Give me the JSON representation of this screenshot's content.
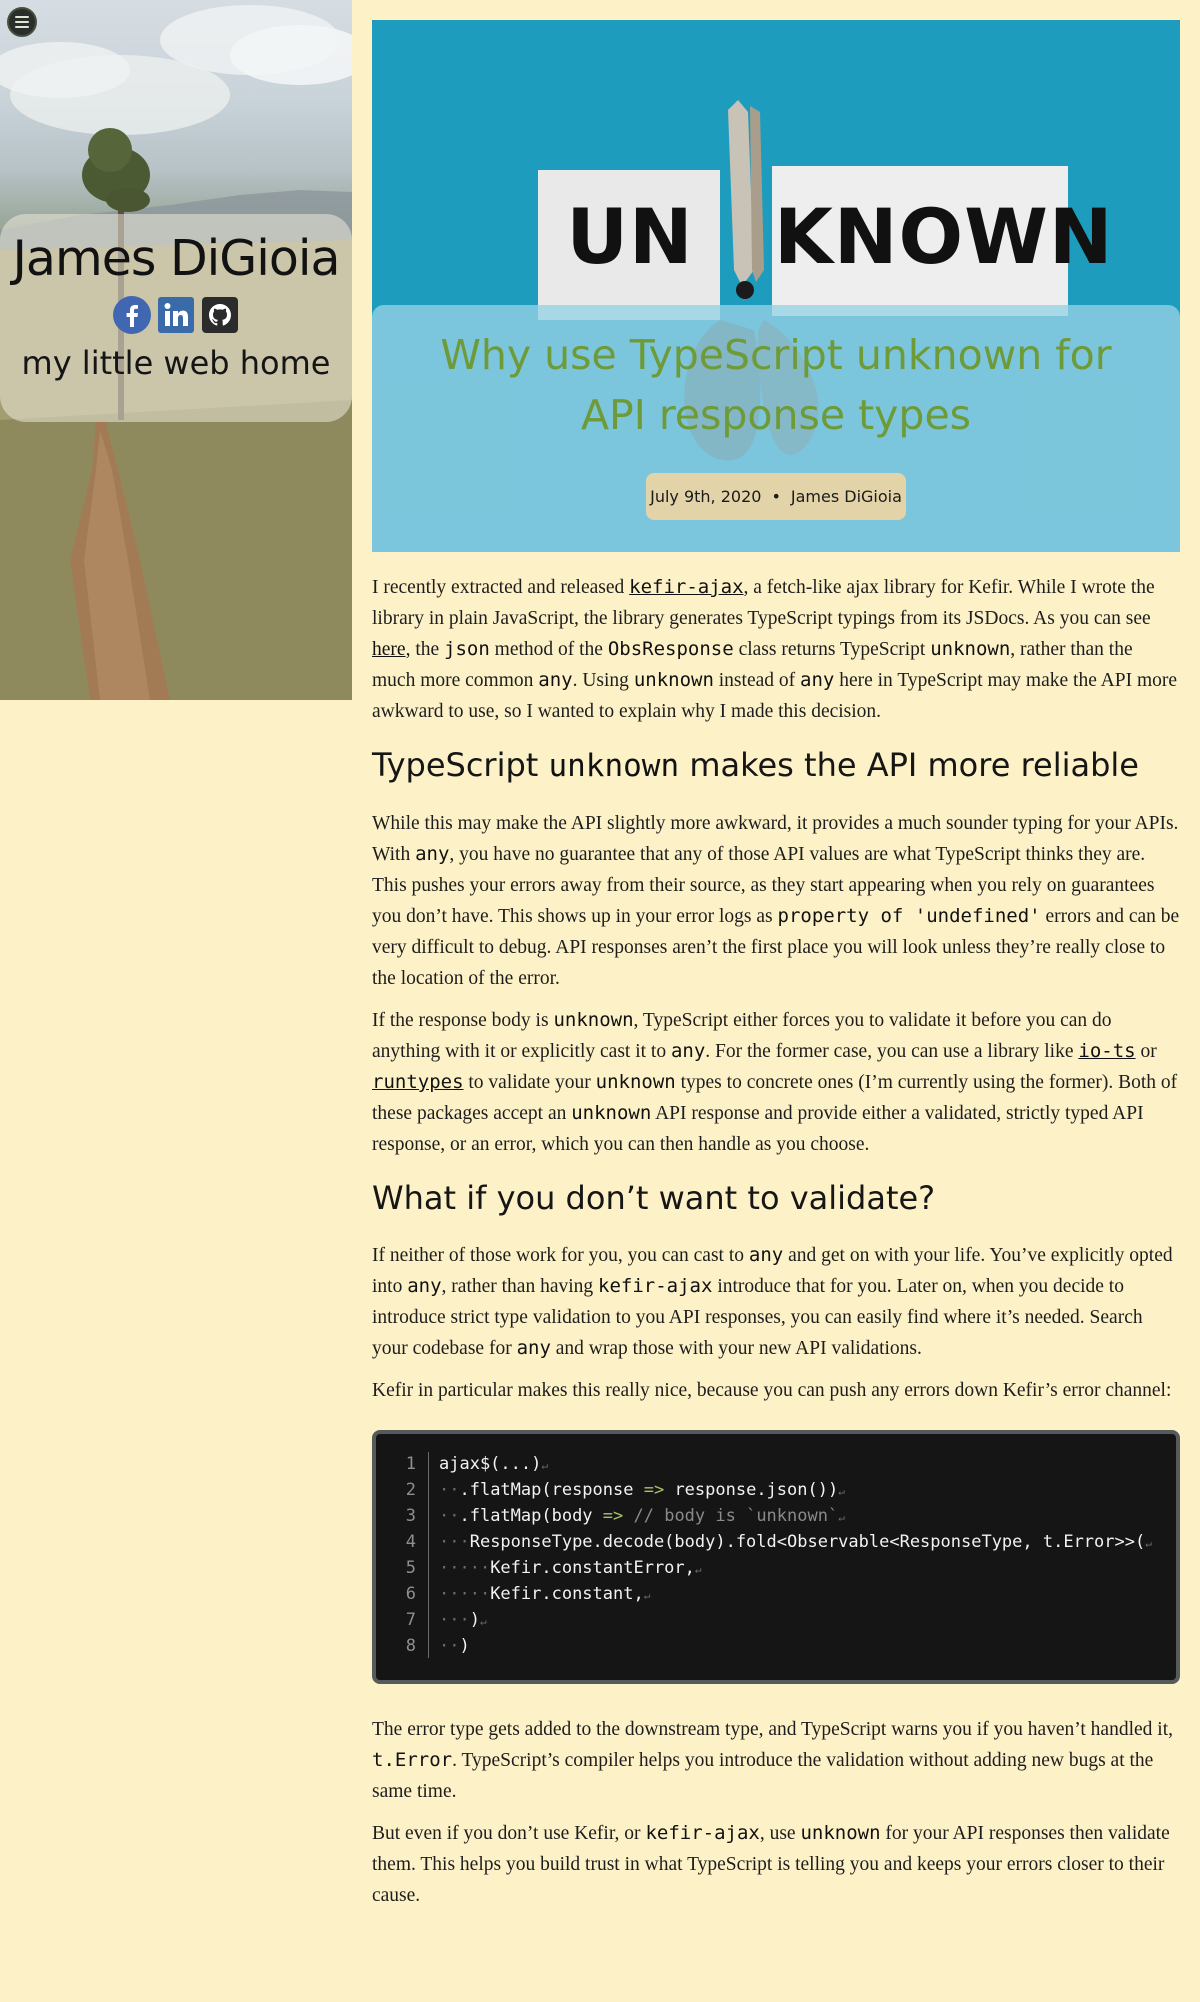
{
  "sidebar": {
    "menu_icon": "hamburger-menu-icon",
    "site_name": "James DiGioia",
    "tagline": "my little web home",
    "social": [
      {
        "name": "facebook-icon",
        "color": "#4267b2"
      },
      {
        "name": "linkedin-icon",
        "color": "#3b6aa8"
      },
      {
        "name": "github-icon",
        "color": "#2b2b2b"
      }
    ]
  },
  "hero": {
    "image_text_left": "UN",
    "image_text_right": "KNOWN",
    "title": "Why use TypeScript unknown for API response types",
    "date": "July 9th, 2020",
    "separator": "•",
    "author": "James DiGioia"
  },
  "article": {
    "p1": {
      "t1": "I recently extracted and released ",
      "link1": "kefir-ajax",
      "t2": ", a fetch-like ajax library for Kefir. While I wrote the library in plain JavaScript, the library generates TypeScript typings from its JSDocs. As you can see ",
      "link2": "here",
      "t3": ", the ",
      "c1": "json",
      "t4": " method of the ",
      "c2": "ObsResponse",
      "t5": " class returns TypeScript ",
      "c3": "unknown",
      "t6": ", rather than the much more common ",
      "c4": "any",
      "t7": ". Using ",
      "c5": "unknown",
      "t8": " instead of ",
      "c6": "any",
      "t9": " here in TypeScript may make the API more awkward to use, so I wanted to explain why I made this decision."
    },
    "h1": {
      "t1": "TypeScript ",
      "c1": "unknown",
      "t2": " makes the API more reliable"
    },
    "p2": {
      "t1": "While this may make the API slightly more awkward, it provides a much sounder typing for your APIs. With ",
      "c1": "any",
      "t2": ", you have no guarantee that any of those API values are what TypeScript thinks they are. This pushes your errors away from their source, as they start appearing when you rely on guarantees you don’t have. This shows up in your error logs as ",
      "c2": "property of 'undefined'",
      "t3": " errors and can be very difficult to debug. API responses aren’t the first place you will look unless they’re really close to the location of the error."
    },
    "p3": {
      "t1": "If the response body is ",
      "c1": "unknown",
      "t2": ", TypeScript either forces you to validate it before you can do anything with it or explicitly cast it to ",
      "c2": "any",
      "t3": ". For the former case, you can use a library like ",
      "link1": "io-ts",
      "t4": " or ",
      "link2": "runtypes",
      "t5": " to validate your ",
      "c3": "unknown",
      "t6": " types to concrete ones (I’m currently using the former). Both of these packages accept an ",
      "c4": "unknown",
      "t7": " API response and provide either a validated, strictly typed API response, or an error, which you can then handle as you choose."
    },
    "h2": "What if you don’t want to validate?",
    "p4": {
      "t1": "If neither of those work for you, you can cast to ",
      "c1": "any",
      "t2": " and get on with your life. You’ve explicitly opted into ",
      "c2": "any",
      "t3": ", rather than having ",
      "c3": "kefir-ajax",
      "t4": " introduce that for you. Later on, when you decide to introduce strict type validation to you API responses, you can easily find where it’s needed. Search your codebase for ",
      "c4": "any",
      "t5": " and wrap those with your new API validations."
    },
    "p5": "Kefir in particular makes this really nice, because you can push any errors down Kefir’s error channel:",
    "code": {
      "line_numbers": [
        "1",
        "2",
        "3",
        "4",
        "5",
        "6",
        "7",
        "8"
      ],
      "l1": {
        "a": "ajax$(...)"
      },
      "l2": {
        "ws": "··",
        "a": ".flatMap(response",
        "b": " => ",
        "c": "response.json())"
      },
      "l3": {
        "ws": "··",
        "a": ".flatMap(body",
        "b": " => ",
        "c": "// body is `unknown`"
      },
      "l4": {
        "ws": "···",
        "a": "ResponseType.decode(body).fold<Observable<ResponseType, t.Error>>("
      },
      "l5": {
        "ws": "·····",
        "a": "Kefir.constantError,"
      },
      "l6": {
        "ws": "·····",
        "a": "Kefir.constant,"
      },
      "l7": {
        "ws": "···",
        "a": ")"
      },
      "l8": {
        "ws": "··",
        "a": ")"
      },
      "eol_mark": "↵"
    },
    "p6": {
      "t1": "The error type gets added to the downstream type, and TypeScript warns you if you haven’t handled it, ",
      "c1": "t.Error",
      "t2": ". TypeScript’s compiler helps you introduce the validation without adding new bugs at the same time."
    },
    "p7": {
      "t1": "But even if you don’t use Kefir, or ",
      "c1": "kefir-ajax",
      "t2": ", use ",
      "c2": "unknown",
      "t3": " for your API responses then validate them. This helps you build trust in what TypeScript is telling you and keeps your errors closer to their cause."
    }
  }
}
